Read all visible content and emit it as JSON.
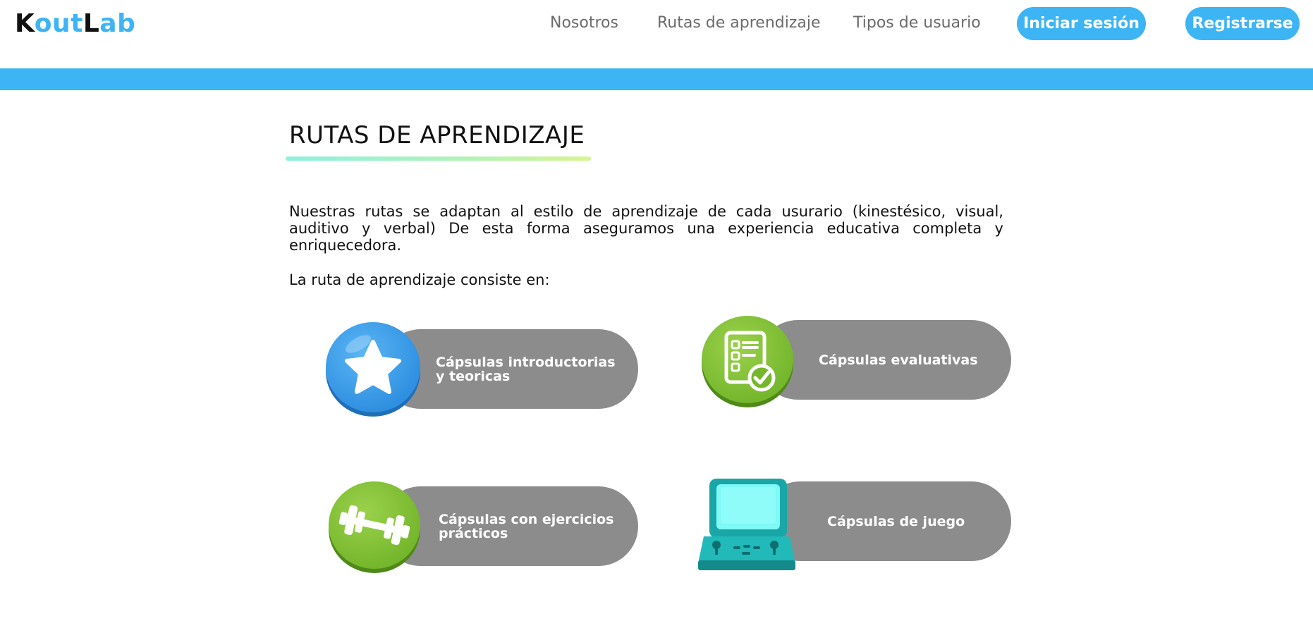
{
  "header": {
    "logo": {
      "k": "K",
      "out": "out",
      "l": "L",
      "ab": "ab"
    },
    "nav": [
      {
        "label": "Nosotros"
      },
      {
        "label": "Rutas de aprendizaje"
      },
      {
        "label": "Tipos de usuario"
      }
    ],
    "login_label": "Iniciar sesión",
    "register_label": "Registrarse"
  },
  "main": {
    "title": "RUTAS DE APRENDIZAJE",
    "intro": "Nuestras rutas se adaptan al estilo de aprendizaje de cada usurario (kinestésico, visual, auditivo y verbal) De esta forma aseguramos una experiencia educativa completa y enriquecedora.",
    "consists": "La ruta de aprendizaje consiste en:",
    "capsules": [
      {
        "line1": "Cápsulas introductorias",
        "line2": "y teoricas",
        "icon": "star-icon"
      },
      {
        "line1": "Cápsulas evaluativas",
        "line2": "",
        "icon": "checklist-icon"
      },
      {
        "line1": "Cápsulas con ejercicios",
        "line2": "prácticos",
        "icon": "dumbbell-icon"
      },
      {
        "line1": "Cápsulas de juego",
        "line2": "",
        "icon": "arcade-icon"
      }
    ]
  },
  "colors": {
    "brand_blue": "#3db4f4",
    "pill_gray": "#8c8c8c",
    "green": "#8cc63f"
  }
}
